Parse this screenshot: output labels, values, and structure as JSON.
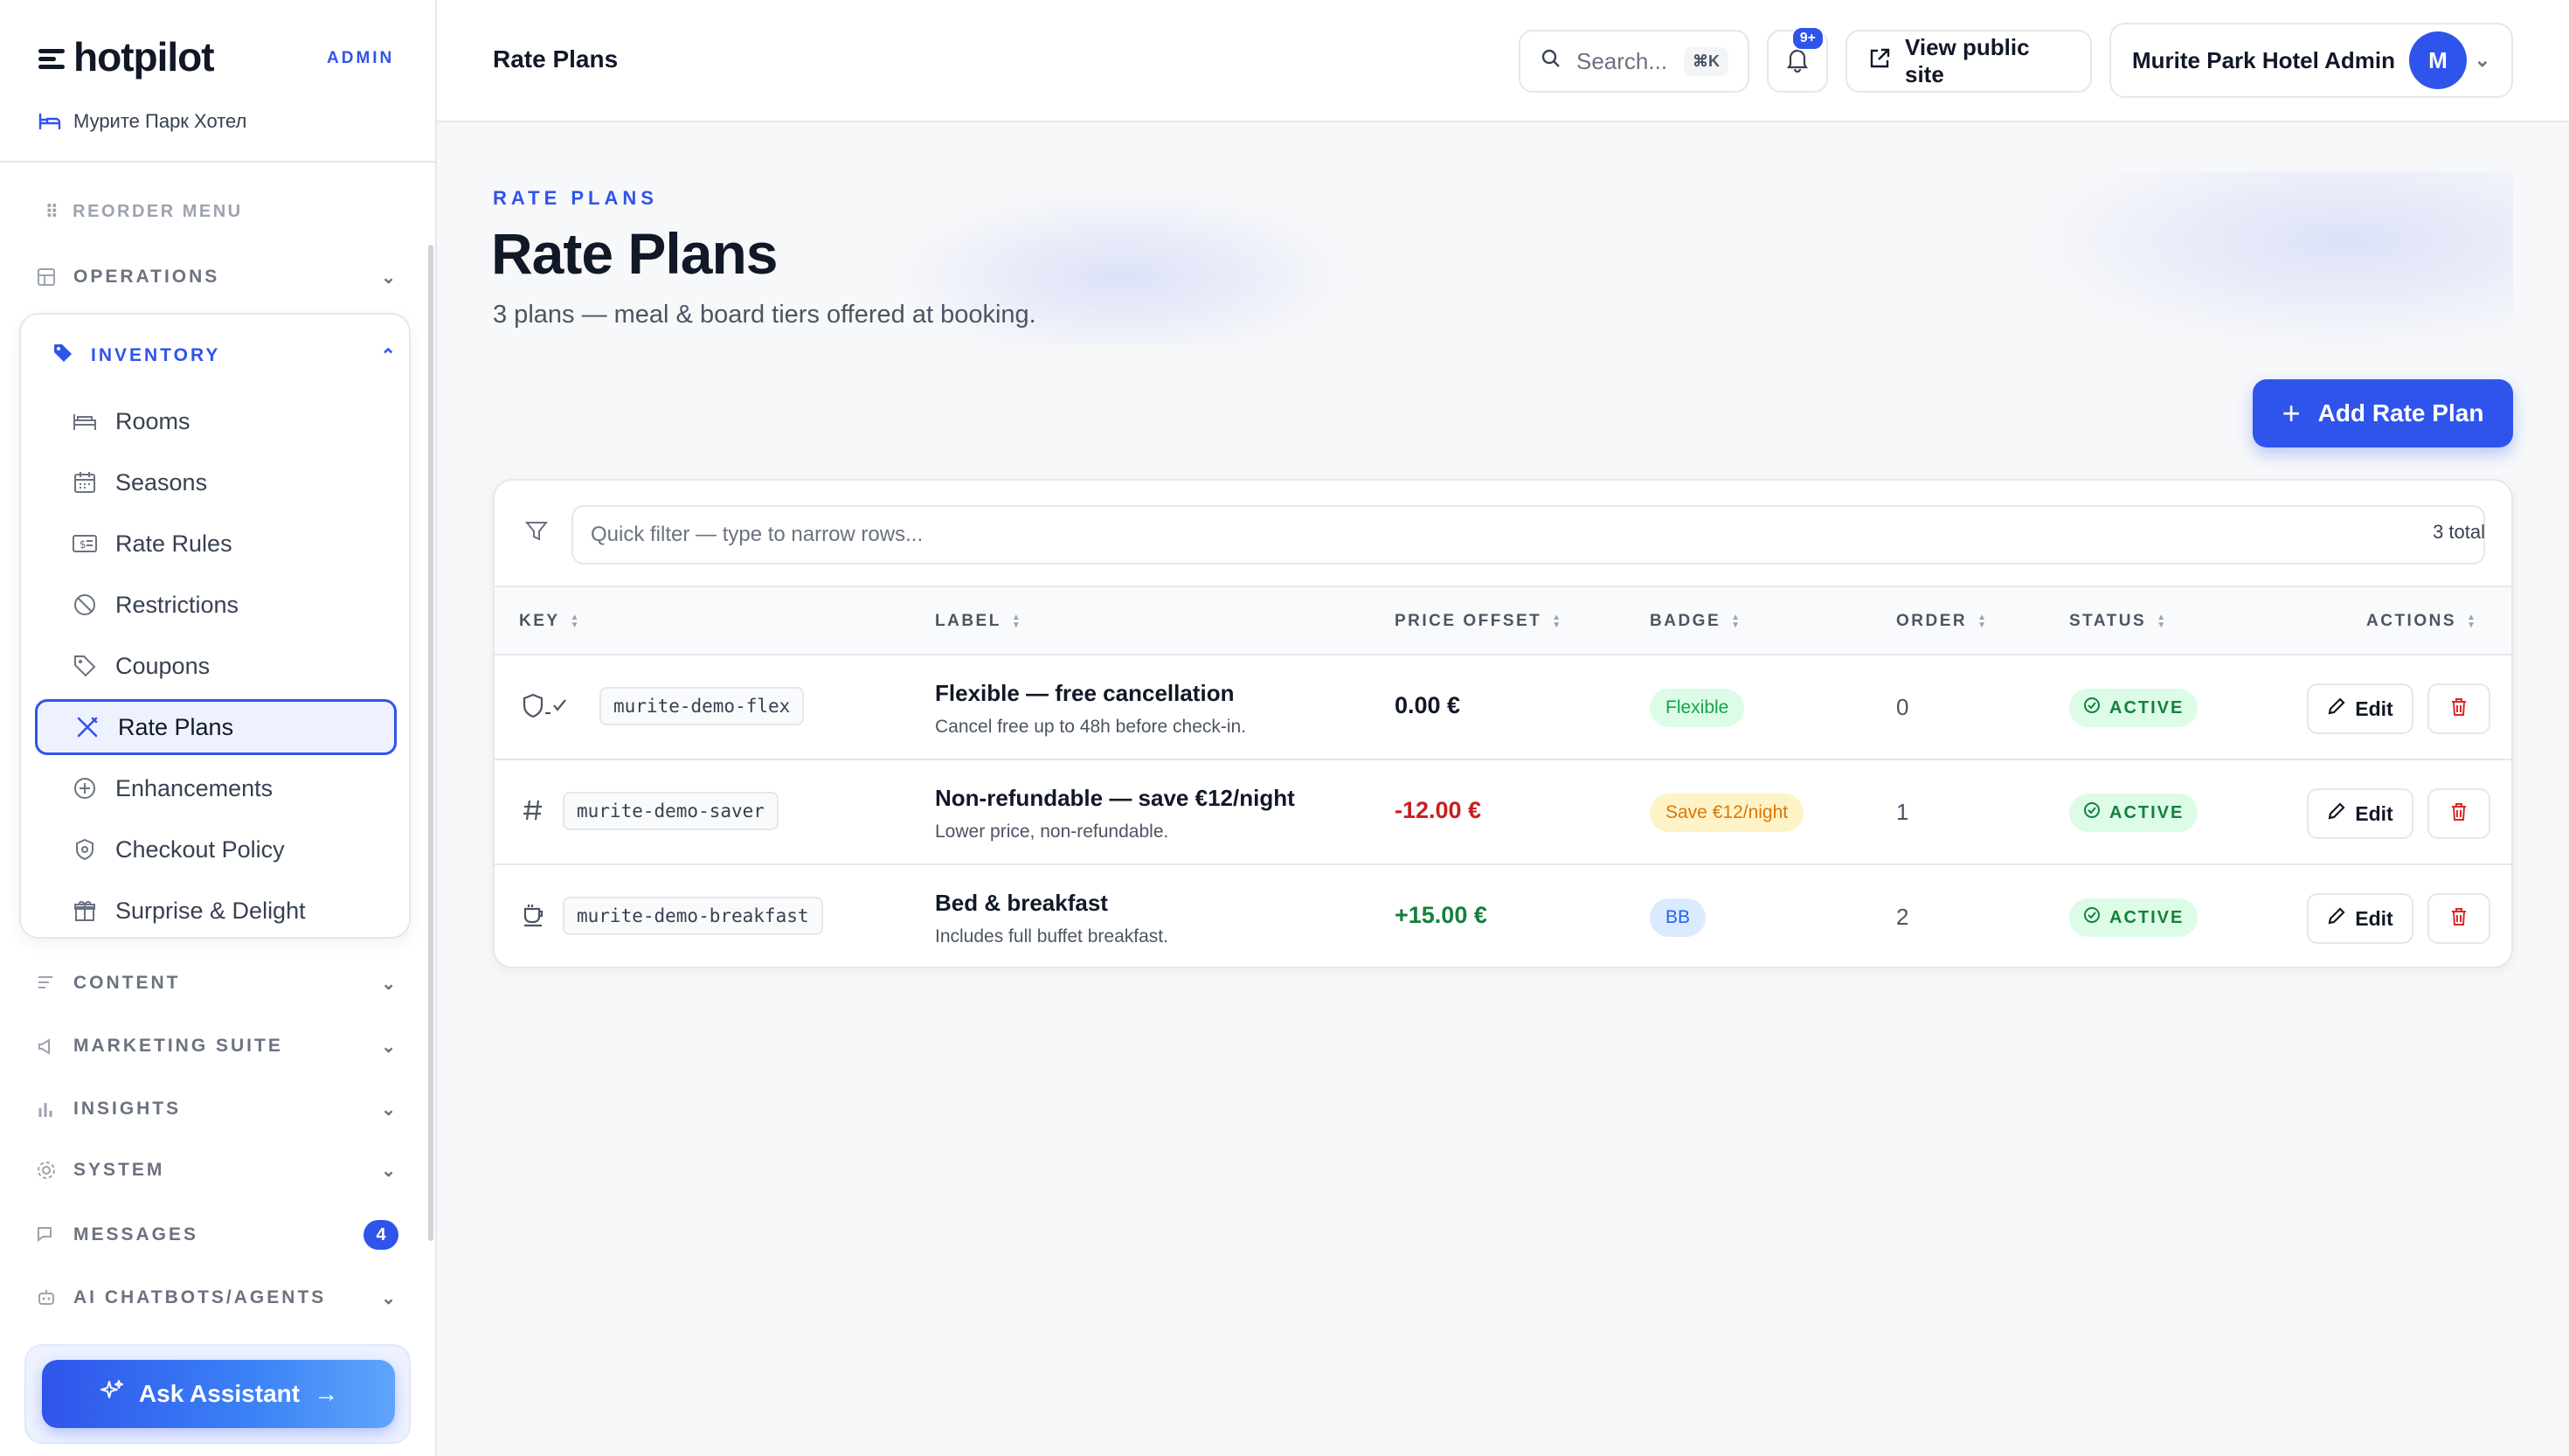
{
  "sidebar": {
    "brand": "hotpilot",
    "brand_tag": "ADMIN",
    "hotel_name": "Мурите Парк Хотел",
    "reorder_label": "REORDER MENU",
    "groups": {
      "operations": "OPERATIONS",
      "inventory": "INVENTORY",
      "content": "CONTENT",
      "marketing": "MARKETING SUITE",
      "insights": "INSIGHTS",
      "system": "SYSTEM",
      "messages": "MESSAGES",
      "messages_count": "4",
      "ai": "AI CHATBOTS/AGENTS"
    },
    "inventory_items": [
      {
        "label": "Rooms",
        "icon": "bed-icon"
      },
      {
        "label": "Seasons",
        "icon": "calendar-icon"
      },
      {
        "label": "Rate Rules",
        "icon": "money-icon"
      },
      {
        "label": "Restrictions",
        "icon": "ban-icon"
      },
      {
        "label": "Coupons",
        "icon": "tag-icon"
      },
      {
        "label": "Rate Plans",
        "icon": "utensils-icon",
        "active": true
      },
      {
        "label": "Enhancements",
        "icon": "plus-circle-icon"
      },
      {
        "label": "Checkout Policy",
        "icon": "shield-icon"
      },
      {
        "label": "Surprise & Delight",
        "icon": "gift-icon"
      }
    ],
    "assistant_label": "Ask Assistant"
  },
  "topbar": {
    "breadcrumb": "Rate Plans",
    "search_placeholder": "Search...",
    "search_shortcut": "⌘K",
    "notif_badge": "9+",
    "public_site_label": "View public site",
    "user_name": "Murite Park Hotel Admin",
    "user_initial": "M"
  },
  "page": {
    "eyebrow": "RATE PLANS",
    "title": "Rate Plans",
    "subtitle": "3 plans — meal & board tiers offered at booking.",
    "add_label": "Add Rate Plan"
  },
  "table": {
    "filter_placeholder": "Quick filter — type to narrow rows...",
    "total": "3 total",
    "columns": {
      "key": "KEY",
      "label": "LABEL",
      "price": "PRICE OFFSET",
      "badge": "BADGE",
      "order": "ORDER",
      "status": "STATUS",
      "actions": "ACTIONS"
    },
    "rows": [
      {
        "icon": "shield-check-icon",
        "key": "murite-demo-flex",
        "title": "Flexible — free cancellation",
        "desc": "Cancel free up to 48h before check-in.",
        "price": "0.00 €",
        "badge": "Flexible",
        "order": "0",
        "status": "ACTIVE",
        "edit": "Edit"
      },
      {
        "icon": "hash-icon",
        "key": "murite-demo-saver",
        "title": "Non-refundable — save €12/night",
        "desc": "Lower price, non-refundable.",
        "price": "-12.00 €",
        "badge": "Save €12/night",
        "order": "1",
        "status": "ACTIVE",
        "edit": "Edit"
      },
      {
        "icon": "coffee-icon",
        "key": "murite-demo-breakfast",
        "title": "Bed & breakfast",
        "desc": "Includes full buffet breakfast.",
        "price": "+15.00 €",
        "badge": "BB",
        "order": "2",
        "status": "ACTIVE",
        "edit": "Edit"
      }
    ]
  },
  "colors": {
    "accent": "#2f54eb",
    "negative": "#c81e1e",
    "positive": "#15803d",
    "badge_flexible_bg": "#dcfce7",
    "badge_saver_bg": "#fef3c7",
    "badge_bb_bg": "#dbeafe"
  }
}
